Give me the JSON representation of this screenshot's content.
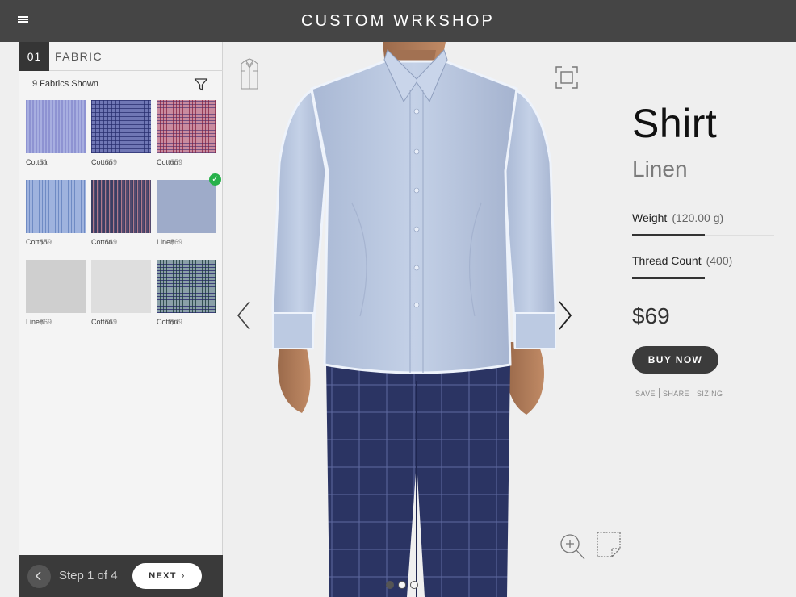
{
  "header": {
    "brand": "CUSTOM WRKSHOP",
    "menu_icon": "hamburger-menu-icon"
  },
  "step": {
    "number": "01",
    "title": "FABRIC",
    "fabrics_shown": "9 Fabrics Shown",
    "filter_icon": "filter-funnel-icon",
    "progress_label": "Step 1 of 4",
    "next_label": "NEXT",
    "current_step": 1,
    "total_steps": 4
  },
  "fabrics": [
    {
      "name": "Cotton",
      "price": "$1"
    },
    {
      "name": "Cotton",
      "price": "$59"
    },
    {
      "name": "Cotton",
      "price": "$59"
    },
    {
      "name": "Cotton",
      "price": "$59"
    },
    {
      "name": "Cotton",
      "price": "$69"
    },
    {
      "name": "Linen",
      "price": "$69",
      "selected": true
    },
    {
      "name": "Linen",
      "price": "$69"
    },
    {
      "name": "Cotton",
      "price": "$69"
    },
    {
      "name": "Cotton",
      "price": "$79"
    }
  ],
  "viewer": {
    "active_view": 1,
    "view_count": 3,
    "colors": {
      "shirt": "#b9c8e0",
      "pants": "#2c3566",
      "skin": "#b07a58"
    }
  },
  "product": {
    "title": "Shirt",
    "fabric": "Linen",
    "weight_label": "Weight",
    "weight_value": "(120.00 g)",
    "thread_label": "Thread Count",
    "thread_value": "(400)",
    "price": "$69",
    "buy_label": "BUY NOW",
    "actions": [
      "SAVE",
      "SHARE",
      "SIZING"
    ]
  },
  "colors": {
    "topbar": "#454545",
    "accent_dark": "#3b3b3b",
    "selected_check": "#27b14a"
  }
}
